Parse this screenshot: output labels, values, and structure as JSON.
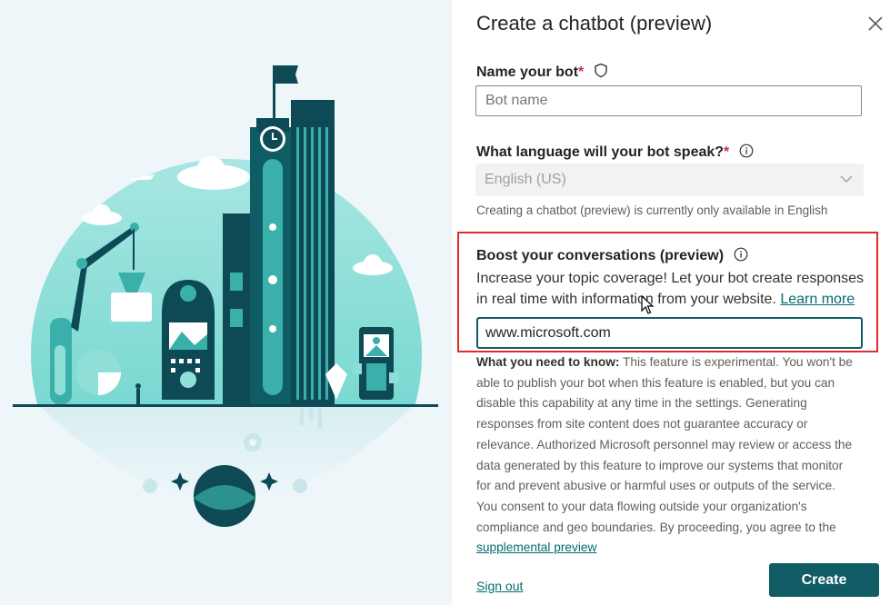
{
  "dialog": {
    "title": "Create a chatbot (preview)"
  },
  "name_field": {
    "label": "Name your bot",
    "required_mark": "*",
    "placeholder": "Bot name"
  },
  "language_field": {
    "label": "What language will your bot speak?",
    "required_mark": "*",
    "selected": "English (US)",
    "hint": "Creating a chatbot (preview) is currently only available in English"
  },
  "boost": {
    "label": "Boost your conversations (preview)",
    "description": "Increase your topic coverage! Let your bot create responses in real time with information from your website.",
    "learn_more": "Learn more",
    "url_value": "www.microsoft.com"
  },
  "notice": {
    "lead": "What you need to know:",
    "body": "This feature is experimental. You won't be able to publish your bot when this feature is enabled, but you can disable this capability at any time in the settings. Generating responses from site content does not guarantee accuracy or relevance. Authorized Microsoft personnel may review or access the data generated by this feature to improve our systems that monitor for and prevent abusive or harmful uses or outputs of the service. You consent to your data flowing outside your organization's compliance and geo boundaries. By proceeding, you agree to the",
    "link": "supplemental preview"
  },
  "footer": {
    "sign_out": "Sign out",
    "create": "Create"
  },
  "icons": {
    "close": "close-icon",
    "shield": "shield-icon",
    "info": "info-icon",
    "chevron": "chevron-down-icon",
    "cursor": "mouse-cursor-icon"
  },
  "colors": {
    "accent": "#0f5c64",
    "link": "#036c70",
    "highlight_border": "#e32b2b",
    "required": "#c4314b"
  }
}
